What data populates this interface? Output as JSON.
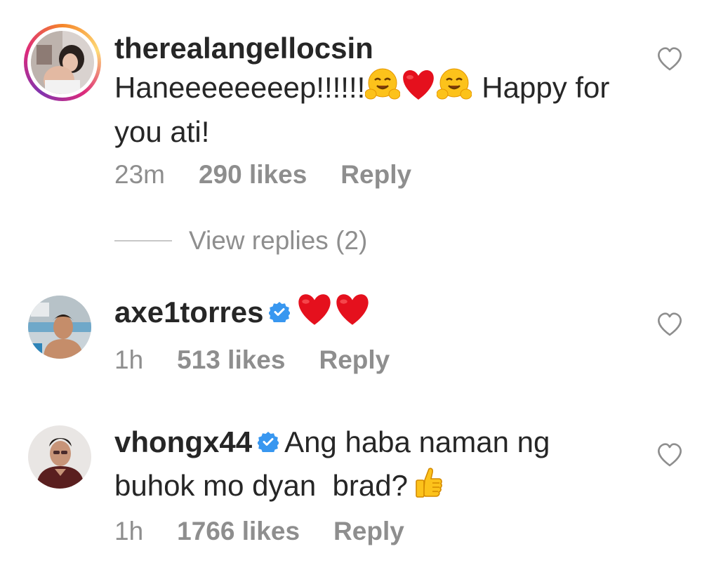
{
  "comments": [
    {
      "username": "therealangellocsin",
      "verified": false,
      "text_line1": "Haneeeeeeeep!!!!!!",
      "text_line1_after": "Happy for",
      "text_line2": "you ati!",
      "time": "23m",
      "likes": "290 likes",
      "reply": "Reply",
      "emojis": [
        "hugging-face",
        "red-heart",
        "hugging-face"
      ]
    },
    {
      "username": "axe1torres",
      "verified": true,
      "time": "1h",
      "likes": "513 likes",
      "reply": "Reply",
      "emojis": [
        "red-heart",
        "red-heart"
      ]
    },
    {
      "username": "vhongx44",
      "verified": true,
      "text_line1": "Ang haba naman ng",
      "text_line2": "buhok mo dyan  brad?",
      "time": "1h",
      "likes": "1766 likes",
      "reply": "Reply",
      "emojis": [
        "thumbs-up"
      ]
    }
  ],
  "view_replies": "View replies (2)",
  "colors": {
    "text": "#262626",
    "muted": "#8e8e8e",
    "verified_blue": "#3897f0",
    "story_ring_start": "#f58529",
    "story_ring_end": "#dd2a7b",
    "heart_red": "#ed1c24"
  },
  "icons": [
    "like-heart-outline-icon",
    "verified-badge-icon"
  ]
}
